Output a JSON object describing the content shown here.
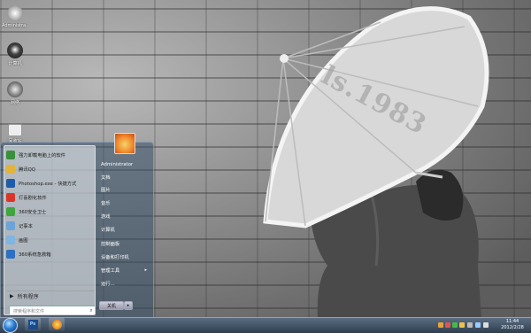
{
  "wallpaper": {
    "watermark": "ls.1983"
  },
  "desktop_icons": [
    {
      "name": "computer",
      "label": "Administra..."
    },
    {
      "name": "network",
      "label": "计算机"
    },
    {
      "name": "ie",
      "label": "网络"
    },
    {
      "name": "trash",
      "label": "回收站"
    }
  ],
  "start_menu": {
    "programs": [
      {
        "label": "强力卸载电脑上的软件",
        "color": "#3a8f3a"
      },
      {
        "label": "腾讯QQ",
        "color": "#e2b43a"
      },
      {
        "label": "Photoshop.exe - 快捷方式",
        "color": "#1c5ca8"
      },
      {
        "label": "打喜剧化软件",
        "color": "#d9362b"
      },
      {
        "label": "360安全卫士",
        "color": "#3fa63f"
      },
      {
        "label": "记事本",
        "color": "#6aa4d8"
      },
      {
        "label": "画图",
        "color": "#7fb5e0"
      },
      {
        "label": "360系统急救箱",
        "color": "#2d6fc2"
      }
    ],
    "all_programs": "所有程序",
    "search_placeholder": "搜索程序和文件",
    "right_items": [
      {
        "label": "Administrator",
        "submenu": false
      },
      {
        "label": "文档",
        "submenu": false
      },
      {
        "label": "图片",
        "submenu": false
      },
      {
        "label": "音乐",
        "submenu": false
      },
      {
        "label": "游戏",
        "submenu": false
      },
      {
        "label": "计算机",
        "submenu": false
      },
      {
        "label": "控制面板",
        "submenu": false
      },
      {
        "label": "设备和打印机",
        "submenu": false
      },
      {
        "label": "管理工具",
        "submenu": true
      },
      {
        "label": "运行...",
        "submenu": false
      }
    ],
    "shutdown_label": "关机",
    "submenu_arrow": "▸"
  },
  "taskbar": {
    "apps": [
      {
        "name": "photoshop",
        "label": "Ps"
      },
      {
        "name": "qq",
        "label": ""
      }
    ],
    "clock_time": "11:44",
    "clock_date": "2012/2/28"
  }
}
